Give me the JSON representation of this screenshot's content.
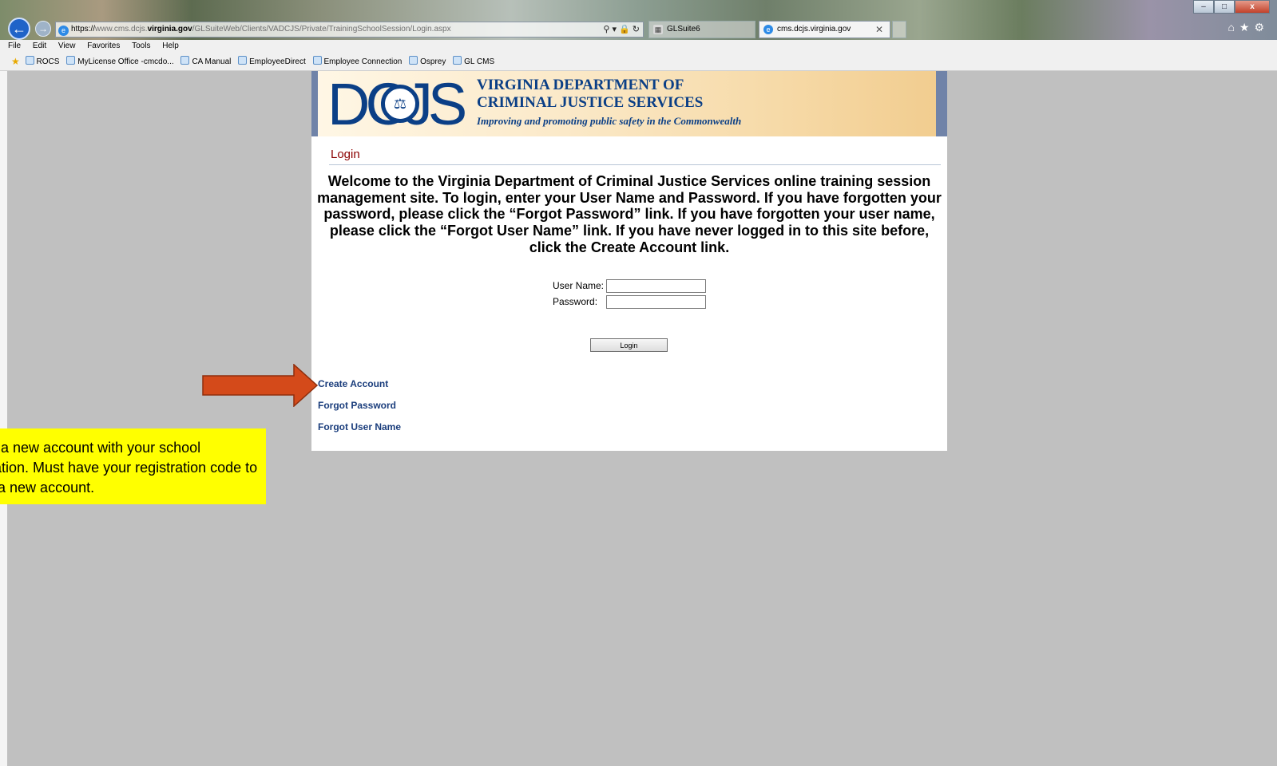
{
  "browser": {
    "url_prefix": "https://",
    "url_host_pre": "www.cms.dcjs.",
    "url_host_bold": "virginia.gov",
    "url_path": "/GLSuiteWeb/Clients/VADCJS/Private/TrainingSchoolSession/Login.aspx",
    "address_icons": "⚲ ▾ 🔒 ↻",
    "tabs": [
      {
        "label": "GLSuite6"
      },
      {
        "label": "cms.dcjs.virginia.gov"
      }
    ],
    "window_controls": [
      "–",
      "□",
      "x"
    ],
    "right_tools": "⌂★⚙"
  },
  "menu": [
    "File",
    "Edit",
    "View",
    "Favorites",
    "Tools",
    "Help"
  ],
  "favorites": [
    "ROCS",
    "MyLicense Office -cmcdo...",
    "CA Manual",
    "EmployeeDirect",
    "Employee Connection",
    "Osprey",
    "GL CMS"
  ],
  "banner": {
    "logo": "DCJS",
    "org_line1": "VIRGINIA DEPARTMENT OF",
    "org_line2": "CRIMINAL JUSTICE SERVICES",
    "tagline": "Improving and promoting public safety in the Commonwealth"
  },
  "login": {
    "title": "Login",
    "welcome": "Welcome to the Virginia Department of Criminal Justice Services online training session management site. To login, enter your User Name and Password. If you have forgotten your password, please click the “Forgot Password” link. If you have forgotten your user name, please click the “Forgot User Name” link. If you have never logged in to this site before, click the Create Account link.",
    "username_label": "User Name:",
    "username_value": "",
    "password_label": "Password:",
    "password_value": "",
    "button": "Login"
  },
  "links": {
    "create_account": "Create Account",
    "forgot_password": "Forgot Password",
    "forgot_username": "Forgot User Name"
  },
  "annotation": {
    "callout_text": "Create a new account with your school information. Must have your registration code to create a new account.",
    "callout_color": "#ffff00",
    "arrow_color": "#d44a1a"
  }
}
